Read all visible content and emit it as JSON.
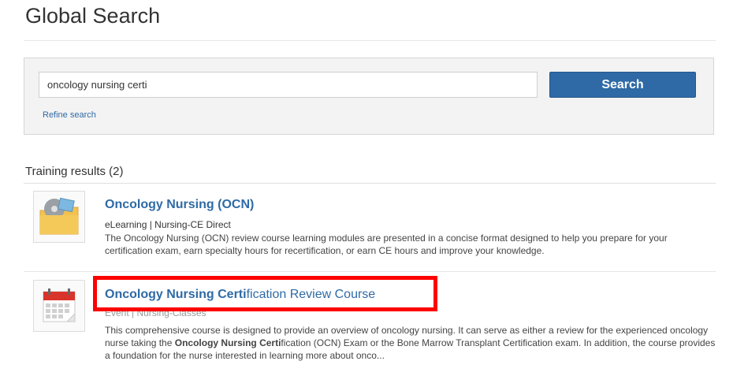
{
  "page": {
    "title": "Global Search"
  },
  "search": {
    "query": "oncology nursing certi",
    "button_label": "Search",
    "refine_label": "Refine search"
  },
  "results": {
    "heading": "Training results (2)",
    "items": [
      {
        "title": "Oncology Nursing (OCN)",
        "meta": "eLearning  |  Nursing-CE Direct",
        "description": "The Oncology Nursing (OCN) review course learning modules are presented in a concise format designed to help you prepare for your certification exam, earn specialty hours for recertification, or earn CE hours and improve your knowledge.",
        "icon": "elearning-folder-icon"
      },
      {
        "title_bold": "Oncology Nursing Certi",
        "title_rest": "fication Review Course",
        "meta": "Event  |  Nursing-Classes",
        "description_part1": "This comprehensive course is designed to provide an overview of oncology nursing. It can serve as either a review for the experienced oncology nurse taking the ",
        "description_bold1": "Oncology Nursing Certi",
        "description_part2": "fication (OCN) Exam or the Bone Marrow Transplant Certification exam. In addition, the course provides a foundation for the nurse interested in learning more about onco...",
        "icon": "calendar-event-icon"
      }
    ]
  },
  "colors": {
    "accent": "#2f6aa6",
    "highlight": "#ff0000"
  }
}
